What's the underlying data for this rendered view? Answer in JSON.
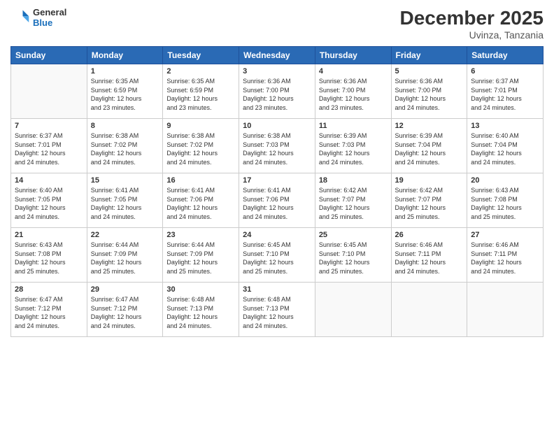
{
  "header": {
    "logo_general": "General",
    "logo_blue": "Blue",
    "month_title": "December 2025",
    "location": "Uvinza, Tanzania"
  },
  "weekdays": [
    "Sunday",
    "Monday",
    "Tuesday",
    "Wednesday",
    "Thursday",
    "Friday",
    "Saturday"
  ],
  "weeks": [
    [
      {
        "day": "",
        "info": ""
      },
      {
        "day": "1",
        "info": "Sunrise: 6:35 AM\nSunset: 6:59 PM\nDaylight: 12 hours\nand 23 minutes."
      },
      {
        "day": "2",
        "info": "Sunrise: 6:35 AM\nSunset: 6:59 PM\nDaylight: 12 hours\nand 23 minutes."
      },
      {
        "day": "3",
        "info": "Sunrise: 6:36 AM\nSunset: 7:00 PM\nDaylight: 12 hours\nand 23 minutes."
      },
      {
        "day": "4",
        "info": "Sunrise: 6:36 AM\nSunset: 7:00 PM\nDaylight: 12 hours\nand 23 minutes."
      },
      {
        "day": "5",
        "info": "Sunrise: 6:36 AM\nSunset: 7:00 PM\nDaylight: 12 hours\nand 24 minutes."
      },
      {
        "day": "6",
        "info": "Sunrise: 6:37 AM\nSunset: 7:01 PM\nDaylight: 12 hours\nand 24 minutes."
      }
    ],
    [
      {
        "day": "7",
        "info": "Sunrise: 6:37 AM\nSunset: 7:01 PM\nDaylight: 12 hours\nand 24 minutes."
      },
      {
        "day": "8",
        "info": "Sunrise: 6:38 AM\nSunset: 7:02 PM\nDaylight: 12 hours\nand 24 minutes."
      },
      {
        "day": "9",
        "info": "Sunrise: 6:38 AM\nSunset: 7:02 PM\nDaylight: 12 hours\nand 24 minutes."
      },
      {
        "day": "10",
        "info": "Sunrise: 6:38 AM\nSunset: 7:03 PM\nDaylight: 12 hours\nand 24 minutes."
      },
      {
        "day": "11",
        "info": "Sunrise: 6:39 AM\nSunset: 7:03 PM\nDaylight: 12 hours\nand 24 minutes."
      },
      {
        "day": "12",
        "info": "Sunrise: 6:39 AM\nSunset: 7:04 PM\nDaylight: 12 hours\nand 24 minutes."
      },
      {
        "day": "13",
        "info": "Sunrise: 6:40 AM\nSunset: 7:04 PM\nDaylight: 12 hours\nand 24 minutes."
      }
    ],
    [
      {
        "day": "14",
        "info": "Sunrise: 6:40 AM\nSunset: 7:05 PM\nDaylight: 12 hours\nand 24 minutes."
      },
      {
        "day": "15",
        "info": "Sunrise: 6:41 AM\nSunset: 7:05 PM\nDaylight: 12 hours\nand 24 minutes."
      },
      {
        "day": "16",
        "info": "Sunrise: 6:41 AM\nSunset: 7:06 PM\nDaylight: 12 hours\nand 24 minutes."
      },
      {
        "day": "17",
        "info": "Sunrise: 6:41 AM\nSunset: 7:06 PM\nDaylight: 12 hours\nand 24 minutes."
      },
      {
        "day": "18",
        "info": "Sunrise: 6:42 AM\nSunset: 7:07 PM\nDaylight: 12 hours\nand 25 minutes."
      },
      {
        "day": "19",
        "info": "Sunrise: 6:42 AM\nSunset: 7:07 PM\nDaylight: 12 hours\nand 25 minutes."
      },
      {
        "day": "20",
        "info": "Sunrise: 6:43 AM\nSunset: 7:08 PM\nDaylight: 12 hours\nand 25 minutes."
      }
    ],
    [
      {
        "day": "21",
        "info": "Sunrise: 6:43 AM\nSunset: 7:08 PM\nDaylight: 12 hours\nand 25 minutes."
      },
      {
        "day": "22",
        "info": "Sunrise: 6:44 AM\nSunset: 7:09 PM\nDaylight: 12 hours\nand 25 minutes."
      },
      {
        "day": "23",
        "info": "Sunrise: 6:44 AM\nSunset: 7:09 PM\nDaylight: 12 hours\nand 25 minutes."
      },
      {
        "day": "24",
        "info": "Sunrise: 6:45 AM\nSunset: 7:10 PM\nDaylight: 12 hours\nand 25 minutes."
      },
      {
        "day": "25",
        "info": "Sunrise: 6:45 AM\nSunset: 7:10 PM\nDaylight: 12 hours\nand 25 minutes."
      },
      {
        "day": "26",
        "info": "Sunrise: 6:46 AM\nSunset: 7:11 PM\nDaylight: 12 hours\nand 24 minutes."
      },
      {
        "day": "27",
        "info": "Sunrise: 6:46 AM\nSunset: 7:11 PM\nDaylight: 12 hours\nand 24 minutes."
      }
    ],
    [
      {
        "day": "28",
        "info": "Sunrise: 6:47 AM\nSunset: 7:12 PM\nDaylight: 12 hours\nand 24 minutes."
      },
      {
        "day": "29",
        "info": "Sunrise: 6:47 AM\nSunset: 7:12 PM\nDaylight: 12 hours\nand 24 minutes."
      },
      {
        "day": "30",
        "info": "Sunrise: 6:48 AM\nSunset: 7:13 PM\nDaylight: 12 hours\nand 24 minutes."
      },
      {
        "day": "31",
        "info": "Sunrise: 6:48 AM\nSunset: 7:13 PM\nDaylight: 12 hours\nand 24 minutes."
      },
      {
        "day": "",
        "info": ""
      },
      {
        "day": "",
        "info": ""
      },
      {
        "day": "",
        "info": ""
      }
    ]
  ]
}
